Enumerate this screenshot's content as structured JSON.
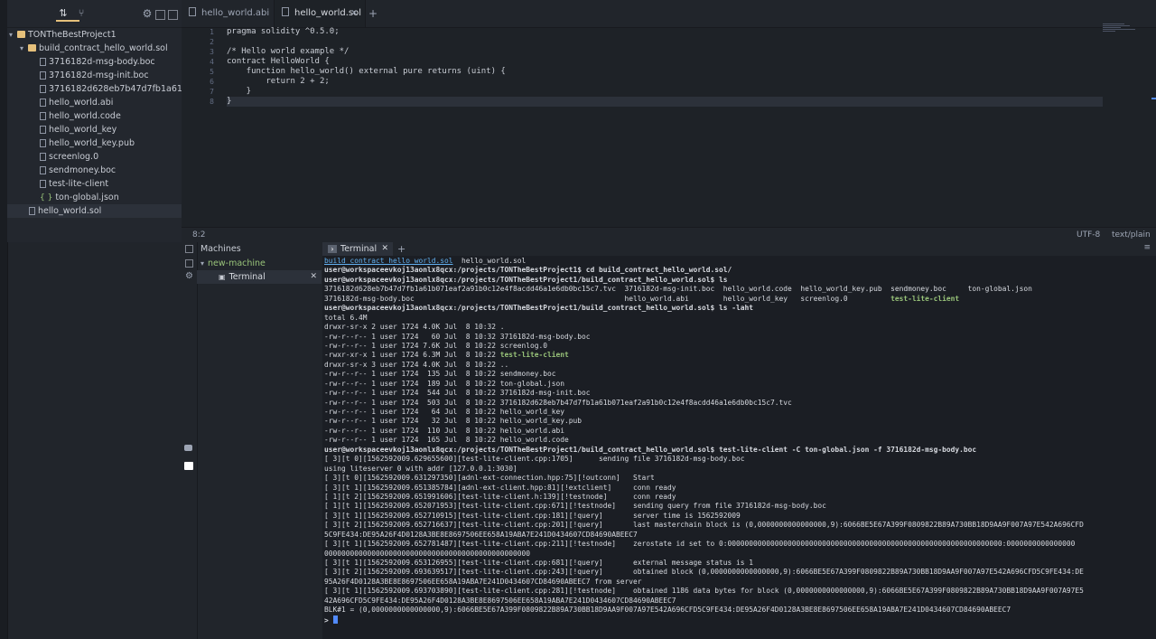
{
  "project": {
    "tree": [
      {
        "label": "TONTheBestProject1",
        "type": "folder",
        "indent": 0,
        "caret": "▾"
      },
      {
        "label": "build_contract_hello_world.sol",
        "type": "folder",
        "indent": 1,
        "caret": "▾"
      },
      {
        "label": "3716182d-msg-body.boc",
        "type": "file",
        "indent": 2
      },
      {
        "label": "3716182d-msg-init.boc",
        "type": "file",
        "indent": 2
      },
      {
        "label": "3716182d628eb7b47d7fb1a61b071eaf2a91b0c12e4f8acdd46a1e6db0bc15c7.tvc",
        "type": "file",
        "indent": 2
      },
      {
        "label": "hello_world.abi",
        "type": "file",
        "indent": 2
      },
      {
        "label": "hello_world.code",
        "type": "file",
        "indent": 2
      },
      {
        "label": "hello_world_key",
        "type": "file",
        "indent": 2
      },
      {
        "label": "hello_world_key.pub",
        "type": "file",
        "indent": 2
      },
      {
        "label": "screenlog.0",
        "type": "file",
        "indent": 2
      },
      {
        "label": "sendmoney.boc",
        "type": "file",
        "indent": 2
      },
      {
        "label": "test-lite-client",
        "type": "file",
        "indent": 2
      },
      {
        "label": "ton-global.json",
        "type": "json",
        "indent": 2
      },
      {
        "label": "hello_world.sol",
        "type": "file",
        "indent": 1,
        "selected": true
      }
    ]
  },
  "editor": {
    "tabs": [
      {
        "label": "hello_world.abi",
        "active": false
      },
      {
        "label": "hello_world.sol",
        "active": true
      }
    ],
    "new_tab": "+",
    "line_numbers": [
      "1",
      "2",
      "3",
      "4",
      "5",
      "6",
      "7",
      "8"
    ],
    "code_lines": [
      "pragma solidity ^0.5.0;",
      "",
      "/* Hello world example */",
      "contract HelloWorld {",
      "    function hello_world() external pure returns (uint) {",
      "        return 2 + 2;",
      "    }",
      "}"
    ],
    "status": {
      "position": "8:2",
      "encoding": "UTF-8",
      "grammar": "text/plain"
    }
  },
  "machines": {
    "title": "Machines",
    "machine": "new-machine",
    "terminal": "Terminal"
  },
  "terminal": {
    "tab_label": "Terminal",
    "add_label": "+",
    "lines": [
      {
        "segs": [
          {
            "t": "build_contract_hello_world.sol",
            "c": "u"
          },
          {
            "t": "  hello_world.sol"
          }
        ]
      },
      {
        "b": true,
        "segs": [
          {
            "t": "user@workspaceevkoj13aonlx8qcx:/projects/TONTheBestProject1$ cd build_contract_hello_world.sol/"
          }
        ]
      },
      {
        "b": true,
        "segs": [
          {
            "t": "user@workspaceevkoj13aonlx8qcx:/projects/TONTheBestProject1/build_contract_hello_world.sol$ ls"
          }
        ]
      },
      {
        "segs": [
          {
            "t": "3716182d628eb7b47d7fb1a61b071eaf2a91b0c12e4f8acdd46a1e6db0bc15c7.tvc  3716182d-msg-init.boc  hello_world.code  hello_world_key.pub  sendmoney.boc     ton-global.json"
          }
        ]
      },
      {
        "segs": [
          {
            "t": "3716182d-msg-body.boc                                                 hello_world.abi        hello_world_key   screenlog.0          "
          },
          {
            "t": "test-lite-client",
            "c": "g"
          }
        ]
      },
      {
        "b": true,
        "segs": [
          {
            "t": "user@workspaceevkoj13aonlx8qcx:/projects/TONTheBestProject1/build_contract_hello_world.sol$ ls -laht"
          }
        ]
      },
      {
        "segs": [
          {
            "t": "total 6.4M"
          }
        ]
      },
      {
        "segs": [
          {
            "t": "drwxr-sr-x 2 user 1724 4.0K Jul  8 10:32 ."
          }
        ]
      },
      {
        "segs": [
          {
            "t": "-rw-r--r-- 1 user 1724   60 Jul  8 10:32 3716182d-msg-body.boc"
          }
        ]
      },
      {
        "segs": [
          {
            "t": "-rw-r--r-- 1 user 1724 7.6K Jul  8 10:22 screenlog.0"
          }
        ]
      },
      {
        "segs": [
          {
            "t": "-rwxr-xr-x 1 user 1724 6.3M Jul  8 10:22 "
          },
          {
            "t": "test-lite-client",
            "c": "g"
          }
        ]
      },
      {
        "segs": [
          {
            "t": "drwxr-sr-x 3 user 1724 4.0K Jul  8 10:22 .."
          }
        ]
      },
      {
        "segs": [
          {
            "t": "-rw-r--r-- 1 user 1724  135 Jul  8 10:22 sendmoney.boc"
          }
        ]
      },
      {
        "segs": [
          {
            "t": "-rw-r--r-- 1 user 1724  189 Jul  8 10:22 ton-global.json"
          }
        ]
      },
      {
        "segs": [
          {
            "t": "-rw-r--r-- 1 user 1724  544 Jul  8 10:22 3716182d-msg-init.boc"
          }
        ]
      },
      {
        "segs": [
          {
            "t": "-rw-r--r-- 1 user 1724  503 Jul  8 10:22 3716182d628eb7b47d7fb1a61b071eaf2a91b0c12e4f8acdd46a1e6db0bc15c7.tvc"
          }
        ]
      },
      {
        "segs": [
          {
            "t": "-rw-r--r-- 1 user 1724   64 Jul  8 10:22 hello_world_key"
          }
        ]
      },
      {
        "segs": [
          {
            "t": "-rw-r--r-- 1 user 1724   32 Jul  8 10:22 hello_world_key.pub"
          }
        ]
      },
      {
        "segs": [
          {
            "t": "-rw-r--r-- 1 user 1724  110 Jul  8 10:22 hello_world.abi"
          }
        ]
      },
      {
        "segs": [
          {
            "t": "-rw-r--r-- 1 user 1724  165 Jul  8 10:22 hello_world.code"
          }
        ]
      },
      {
        "b": true,
        "segs": [
          {
            "t": "user@workspaceevkoj13aonlx8qcx:/projects/TONTheBestProject1/build_contract_hello_world.sol$ test-lite-client -C ton-global.json -f 3716182d-msg-body.boc"
          }
        ]
      },
      {
        "segs": [
          {
            "t": "[ 3][t 0][1562592009.629655600][test-lite-client.cpp:1705]      sending file 3716182d-msg-body.boc"
          }
        ]
      },
      {
        "segs": [
          {
            "t": "using liteserver 0 with addr [127.0.0.1:3030]"
          }
        ]
      },
      {
        "segs": [
          {
            "t": "[ 3][t 0][1562592009.631297350][adnl-ext-connection.hpp:75][!outconn]   Start"
          }
        ]
      },
      {
        "segs": [
          {
            "t": "[ 3][t 1][1562592009.651385784][adnl-ext-client.hpp:81][!extclient]     conn ready"
          }
        ]
      },
      {
        "segs": [
          {
            "t": "[ 1][t 2][1562592009.651991606][test-lite-client.h:139][!testnode]      conn ready"
          }
        ]
      },
      {
        "segs": [
          {
            "t": "[ 1][t 1][1562592009.652071953][test-lite-client.cpp:671][!testnode]    sending query from file 3716182d-msg-body.boc"
          }
        ]
      },
      {
        "segs": [
          {
            "t": "[ 3][t 1][1562592009.652710915][test-lite-client.cpp:181][!query]       server time is 1562592009"
          }
        ]
      },
      {
        "segs": [
          {
            "t": "[ 3][t 2][1562592009.652716637][test-lite-client.cpp:201][!query]       last masterchain block is (0,0000000000000000,9):6066BE5E67A399F0809822B89A730BB18D9AA9F007A97E542A696CFD"
          }
        ]
      },
      {
        "segs": [
          {
            "t": "5C9FE434:DE95A26F4D0128A3BE8E8697506EE658A19ABA7E241D0434607CD84690ABEEC7"
          }
        ]
      },
      {
        "segs": [
          {
            "t": "[ 3][t 1][1562592009.652781487][test-lite-client.cpp:211][!testnode]    zerostate id set to 0:0000000000000000000000000000000000000000000000000000000000000000:0000000000000000"
          }
        ]
      },
      {
        "segs": [
          {
            "t": "000000000000000000000000000000000000000000000000"
          }
        ]
      },
      {
        "segs": [
          {
            "t": "[ 3][t 1][1562592009.653126955][test-lite-client.cpp:681][!query]       external message status is 1"
          }
        ]
      },
      {
        "segs": [
          {
            "t": "[ 3][t 2][1562592009.693639517][test-lite-client.cpp:243][!query]       obtained block (0,0000000000000000,9):6066BE5E67A399F0809822B89A730BB18D9AA9F007A97E542A696CFD5C9FE434:DE"
          }
        ]
      },
      {
        "segs": [
          {
            "t": "95A26F4D0128A3BE8E8697506EE658A19ABA7E241D0434607CD84690ABEEC7 from server"
          }
        ]
      },
      {
        "segs": [
          {
            "t": "[ 3][t 1][1562592009.693703890][test-lite-client.cpp:281][!testnode]    obtained 1186 data bytes for block (0,0000000000000000,9):6066BE5E67A399F0809822B89A730BB18D9AA9F007A97E5"
          }
        ]
      },
      {
        "segs": [
          {
            "t": "42A696CFD5C9FE434:DE95A26F4D0128A3BE8E8697506EE658A19ABA7E241D0434607CD84690ABEEC7"
          }
        ]
      },
      {
        "segs": [
          {
            "t": "BLK#1 = (0,0000000000000000,9):6066BE5E67A399F0809822B89A730BB18D9AA9F007A97E542A696CFD5C9FE434:DE95A26F4D0128A3BE8E8697506EE658A19ABA7E241D0434607CD84690ABEEC7"
          }
        ]
      },
      {
        "b": true,
        "prompt": true,
        "segs": [
          {
            "t": "> "
          }
        ]
      }
    ]
  }
}
